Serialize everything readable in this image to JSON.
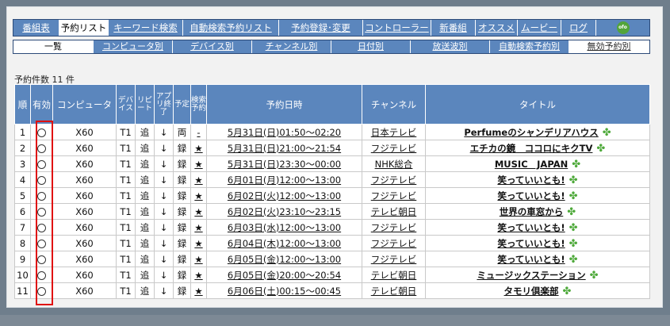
{
  "nav": {
    "items": [
      {
        "label": "番組表",
        "active": false
      },
      {
        "label": "予約リスト",
        "active": true
      },
      {
        "label": "キーワード検索",
        "active": false
      },
      {
        "label": "自動検索予約リスト",
        "active": false
      },
      {
        "label": "予約登録･変更",
        "active": false
      },
      {
        "label": "コントローラー",
        "active": false
      },
      {
        "label": "新番組",
        "active": false
      },
      {
        "label": "オススメ",
        "active": false
      },
      {
        "label": "ムービー",
        "active": false
      },
      {
        "label": "ログ",
        "active": false
      }
    ],
    "logo_text": "ofo"
  },
  "subnav": {
    "items": [
      {
        "label": "一覧"
      },
      {
        "label": "コンピュータ別"
      },
      {
        "label": "デバイス別"
      },
      {
        "label": "チャンネル別"
      },
      {
        "label": "日付別"
      },
      {
        "label": "放送波別"
      },
      {
        "label": "自動検索予約別"
      },
      {
        "label": "無効予約別"
      }
    ]
  },
  "count_label": "予約件数 11 件",
  "table": {
    "headers": {
      "num": "順",
      "enabled": "有効",
      "computer": "コンピュータ",
      "device": "デバイス",
      "repeat": "リピート",
      "after": "アプリ終了",
      "plan": "予定",
      "auto": "検索予約",
      "datetime": "予約日時",
      "channel": "チャンネル",
      "title": "タイトル"
    },
    "rows": [
      {
        "num": "1",
        "computer": "X60",
        "device": "T1",
        "repeat": "追",
        "after": "↓",
        "plan": "両",
        "auto": "-",
        "datetime": "5月31日(日)01:50～02:20",
        "channel": "日本テレビ",
        "title": "Perfumeのシャンデリアハウス"
      },
      {
        "num": "2",
        "computer": "X60",
        "device": "T1",
        "repeat": "追",
        "after": "↓",
        "plan": "録",
        "auto": "★",
        "datetime": "5月31日(日)21:00～21:54",
        "channel": "フジテレビ",
        "title": "エチカの鏡　ココロにキクTV"
      },
      {
        "num": "3",
        "computer": "X60",
        "device": "T1",
        "repeat": "追",
        "after": "↓",
        "plan": "録",
        "auto": "★",
        "datetime": "5月31日(日)23:30～00:00",
        "channel": "NHK総合",
        "title": "MUSIC　JAPAN"
      },
      {
        "num": "4",
        "computer": "X60",
        "device": "T1",
        "repeat": "追",
        "after": "↓",
        "plan": "録",
        "auto": "★",
        "datetime": "6月01日(月)12:00～13:00",
        "channel": "フジテレビ",
        "title": "笑っていいとも!"
      },
      {
        "num": "5",
        "computer": "X60",
        "device": "T1",
        "repeat": "追",
        "after": "↓",
        "plan": "録",
        "auto": "★",
        "datetime": "6月02日(火)12:00～13:00",
        "channel": "フジテレビ",
        "title": "笑っていいとも!"
      },
      {
        "num": "6",
        "computer": "X60",
        "device": "T1",
        "repeat": "追",
        "after": "↓",
        "plan": "録",
        "auto": "★",
        "datetime": "6月02日(火)23:10～23:15",
        "channel": "テレビ朝日",
        "title": "世界の車窓から"
      },
      {
        "num": "7",
        "computer": "X60",
        "device": "T1",
        "repeat": "追",
        "after": "↓",
        "plan": "録",
        "auto": "★",
        "datetime": "6月03日(水)12:00～13:00",
        "channel": "フジテレビ",
        "title": "笑っていいとも!"
      },
      {
        "num": "8",
        "computer": "X60",
        "device": "T1",
        "repeat": "追",
        "after": "↓",
        "plan": "録",
        "auto": "★",
        "datetime": "6月04日(木)12:00～13:00",
        "channel": "フジテレビ",
        "title": "笑っていいとも!"
      },
      {
        "num": "9",
        "computer": "X60",
        "device": "T1",
        "repeat": "追",
        "after": "↓",
        "plan": "録",
        "auto": "★",
        "datetime": "6月05日(金)12:00～13:00",
        "channel": "フジテレビ",
        "title": "笑っていいとも!"
      },
      {
        "num": "10",
        "computer": "X60",
        "device": "T1",
        "repeat": "追",
        "after": "↓",
        "plan": "録",
        "auto": "★",
        "datetime": "6月05日(金)20:00～20:54",
        "channel": "テレビ朝日",
        "title": "ミュージックステーション"
      },
      {
        "num": "11",
        "computer": "X60",
        "device": "T1",
        "repeat": "追",
        "after": "↓",
        "plan": "録",
        "auto": "★",
        "datetime": "6月06日(土)00:15～00:45",
        "channel": "テレビ朝日",
        "title": "タモリ倶楽部"
      }
    ]
  },
  "icons": {
    "enabled": "circle-icon",
    "title_extra": "clover-icon"
  },
  "colors": {
    "header_bg": "#5b86bd",
    "highlight": "#e01010",
    "clover": "#4ea93a",
    "page_bg": "#6f7e8c"
  }
}
